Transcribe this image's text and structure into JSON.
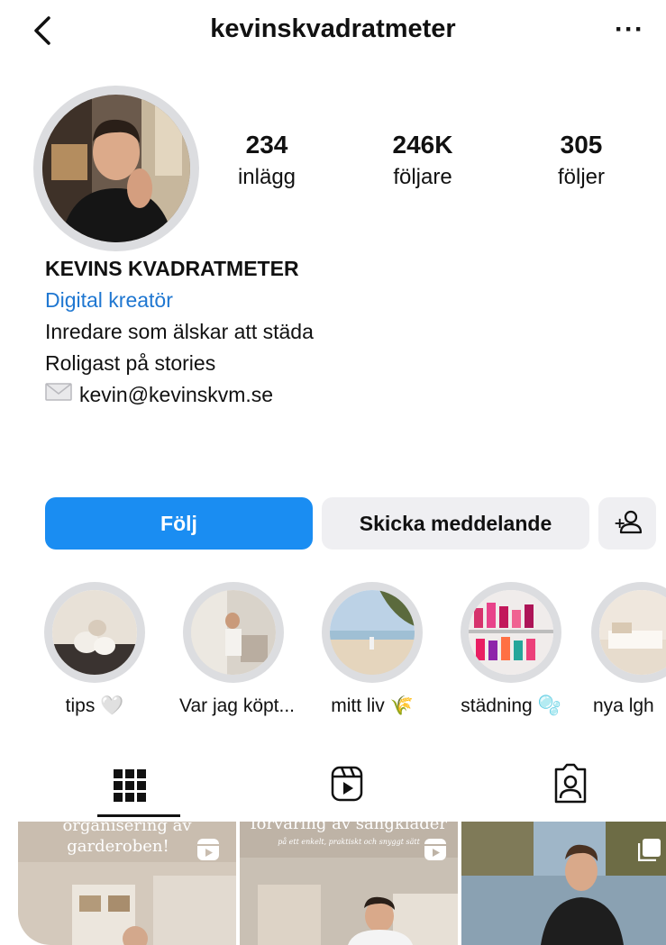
{
  "header": {
    "username": "kevinskvadratmeter",
    "more_label": "···"
  },
  "stats": [
    {
      "value": "234",
      "label": "inlägg"
    },
    {
      "value": "246K",
      "label": "följare"
    },
    {
      "value": "305",
      "label": "följer"
    }
  ],
  "bio": {
    "name": "KEVINS KVADRATMETER",
    "category": "Digital kreatör",
    "line1": "Inredare som älskar att städa",
    "line2": "Roligast på stories",
    "email": "kevin@kevinskvm.se"
  },
  "buttons": {
    "follow": "Följ",
    "message": "Skicka meddelande"
  },
  "highlights": [
    {
      "label": "tips 🤍"
    },
    {
      "label": "Var jag köpt..."
    },
    {
      "label": "mitt liv 🌾"
    },
    {
      "label": "städning 🫧"
    },
    {
      "label": "nya lgh"
    }
  ],
  "grid": [
    {
      "title_line1": "organisering av",
      "title_line2": "garderoben!"
    },
    {
      "title_line1": "förvaring av sängkläder",
      "subtitle": "på ett enkelt, praktiskt och snyggt sätt"
    },
    {
      "title_line1": ""
    }
  ],
  "colors": {
    "accent": "#1a8df2",
    "link": "#1f77d1",
    "button_secondary": "#efeff2"
  }
}
